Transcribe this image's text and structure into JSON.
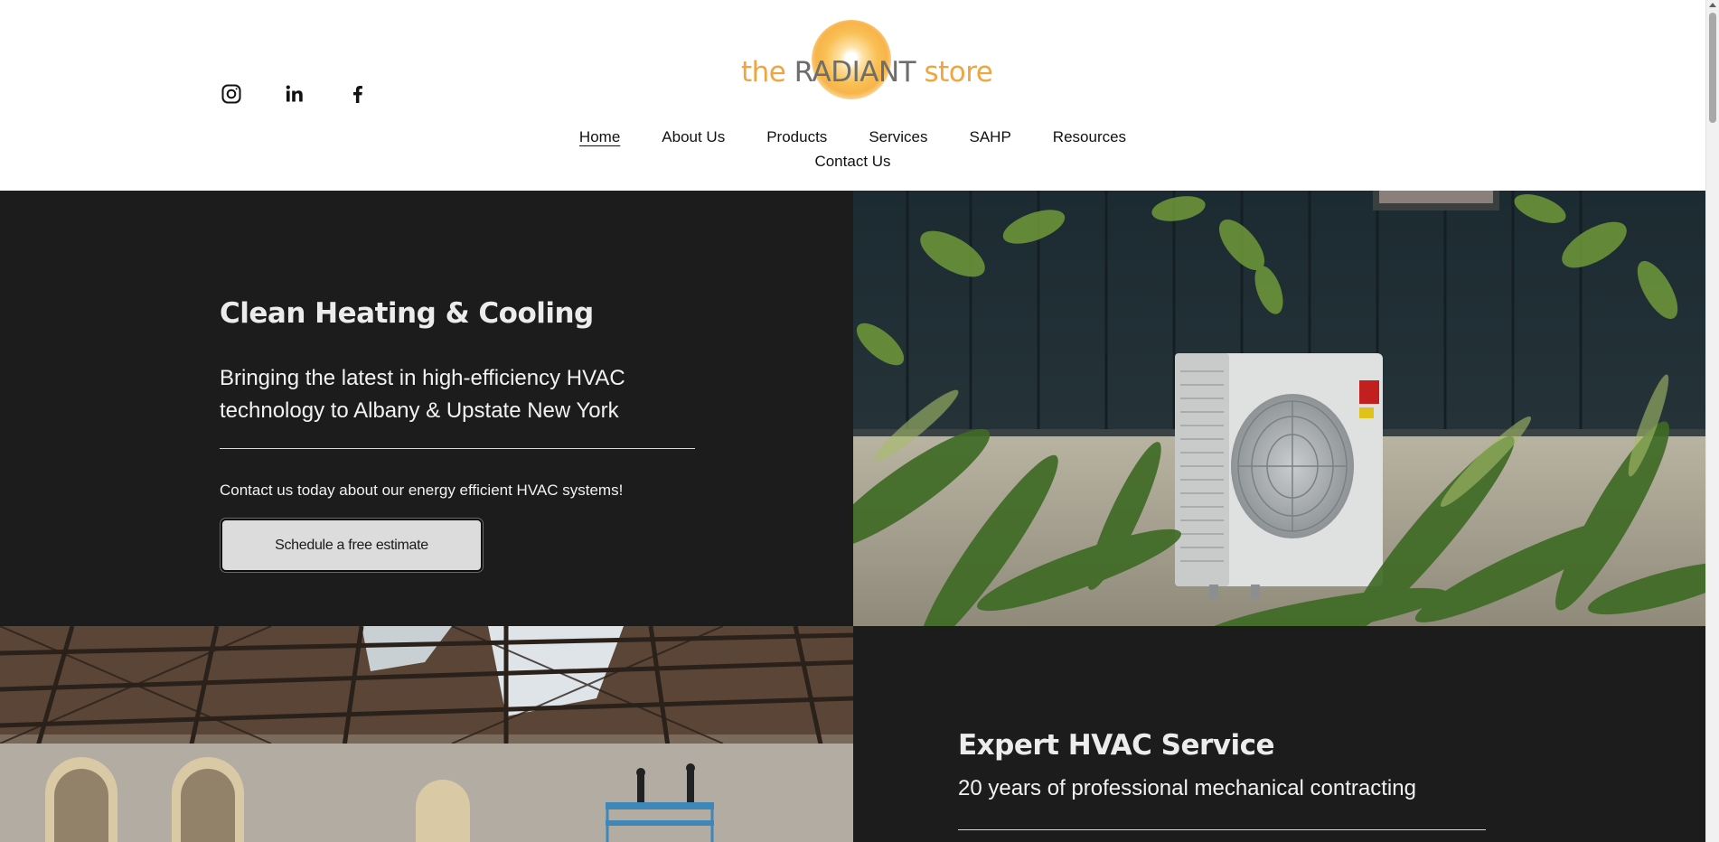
{
  "brand": {
    "logo_text_the": "the",
    "logo_text_radiant": "RADIANT",
    "logo_text_store": "store",
    "accent_color": "#f0a640"
  },
  "social": [
    {
      "icon": "instagram-icon"
    },
    {
      "icon": "linkedin-icon"
    },
    {
      "icon": "facebook-icon"
    }
  ],
  "nav": {
    "items": [
      {
        "label": "Home",
        "active": true
      },
      {
        "label": "About Us"
      },
      {
        "label": "Products"
      },
      {
        "label": "Services"
      },
      {
        "label": "SAHP"
      },
      {
        "label": "Resources"
      },
      {
        "label": "Contact Us"
      }
    ]
  },
  "hero": {
    "title": "Clean Heating & Cooling",
    "subtitle": "Bringing the latest in high-efficiency HVAC technology to Albany & Upstate New York",
    "cta_text": "Contact us today about our energy efficient HVAC systems!",
    "button_label": "Schedule a free estimate",
    "image": "outdoor-heat-pump-unit-photo"
  },
  "service": {
    "title": "Expert HVAC Service",
    "subtitle": "20 years of professional mechanical contracting",
    "image": "warehouse-interior-lift-photo"
  }
}
